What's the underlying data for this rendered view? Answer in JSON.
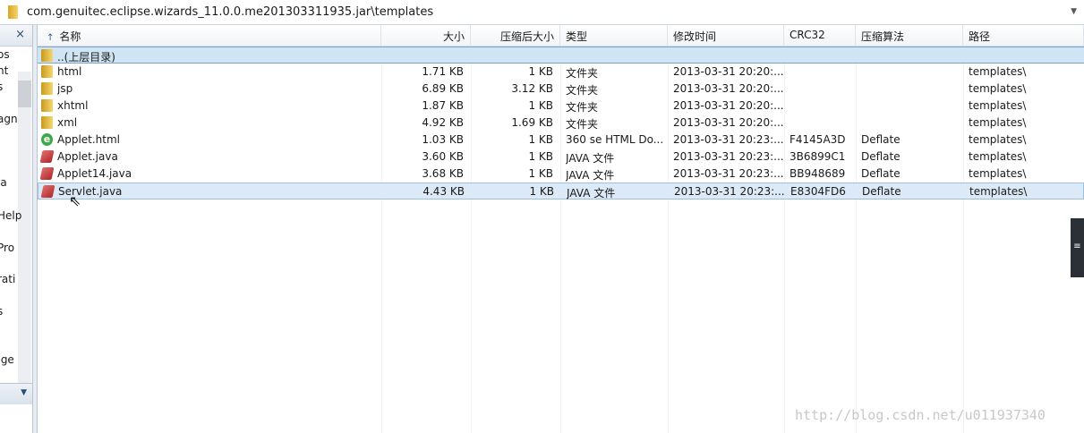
{
  "address": {
    "path": "com.genuitec.eclipse.wizards_11.0.0.me201303311935.jar\\templates"
  },
  "left_pane": {
    "close": "×",
    "items": [
      "os",
      "nt",
      "s",
      "agn",
      "ia",
      "Help",
      "Pro",
      "rati",
      "s",
      ".ge"
    ]
  },
  "columns": [
    "名称",
    "大小",
    "压缩后大小",
    "类型",
    "修改时间",
    "CRC32",
    "压缩算法",
    "路径"
  ],
  "sort_indicator": "↑",
  "rows": [
    {
      "icon": "folder",
      "name": "..(上层目录)",
      "size": "",
      "csize": "",
      "type": "",
      "mtime": "",
      "crc": "",
      "algo": "",
      "path": ""
    },
    {
      "icon": "folder",
      "name": "html",
      "size": "1.71 KB",
      "csize": "1 KB",
      "type": "文件夹",
      "mtime": "2013-03-31 20:20:...",
      "crc": "",
      "algo": "",
      "path": "templates\\"
    },
    {
      "icon": "folder",
      "name": "jsp",
      "size": "6.89 KB",
      "csize": "3.12 KB",
      "type": "文件夹",
      "mtime": "2013-03-31 20:20:...",
      "crc": "",
      "algo": "",
      "path": "templates\\"
    },
    {
      "icon": "folder",
      "name": "xhtml",
      "size": "1.87 KB",
      "csize": "1 KB",
      "type": "文件夹",
      "mtime": "2013-03-31 20:20:...",
      "crc": "",
      "algo": "",
      "path": "templates\\"
    },
    {
      "icon": "folder",
      "name": "xml",
      "size": "4.92 KB",
      "csize": "1.69 KB",
      "type": "文件夹",
      "mtime": "2013-03-31 20:20:...",
      "crc": "",
      "algo": "",
      "path": "templates\\"
    },
    {
      "icon": "ie",
      "name": "Applet.html",
      "size": "1.03 KB",
      "csize": "1 KB",
      "type": "360 se HTML Do...",
      "mtime": "2013-03-31 20:23:...",
      "crc": "F4145A3D",
      "algo": "Deflate",
      "path": "templates\\"
    },
    {
      "icon": "java",
      "name": "Applet.java",
      "size": "3.60 KB",
      "csize": "1 KB",
      "type": "JAVA 文件",
      "mtime": "2013-03-31 20:23:...",
      "crc": "3B6899C1",
      "algo": "Deflate",
      "path": "templates\\"
    },
    {
      "icon": "java",
      "name": "Applet14.java",
      "size": "3.68 KB",
      "csize": "1 KB",
      "type": "JAVA 文件",
      "mtime": "2013-03-31 20:23:...",
      "crc": "BB948689",
      "algo": "Deflate",
      "path": "templates\\"
    },
    {
      "icon": "java",
      "name": "Servlet.java",
      "size": "4.43 KB",
      "csize": "1 KB",
      "type": "JAVA 文件",
      "mtime": "2013-03-31 20:23:...",
      "crc": "E8304FD6",
      "algo": "Deflate",
      "path": "templates\\"
    }
  ],
  "watermark": "http://blog.csdn.net/u011937340"
}
